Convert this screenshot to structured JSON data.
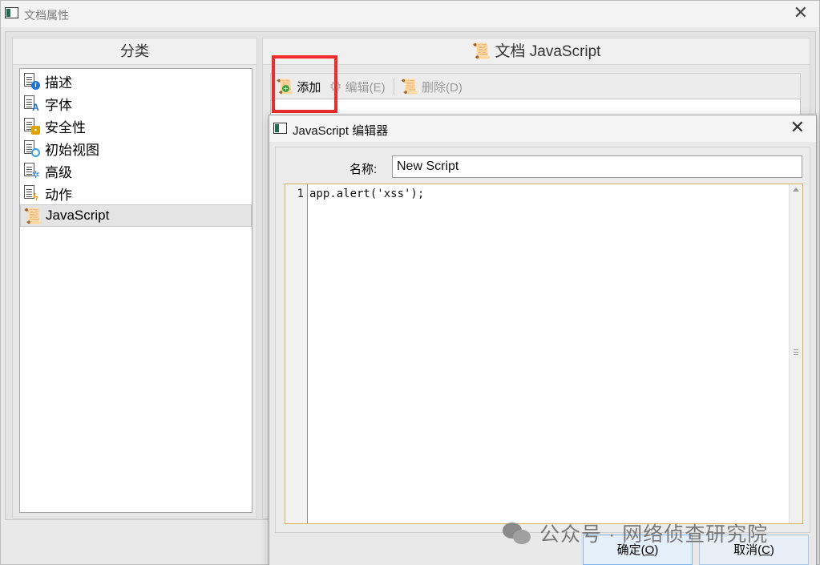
{
  "main_window": {
    "title": "文档属性",
    "close_symbol": "✕"
  },
  "left_panel": {
    "header": "分类",
    "items": [
      {
        "label": "描述",
        "icon": "document-info-icon",
        "badge_color": "#1e73d8"
      },
      {
        "label": "字体",
        "icon": "document-font-icon",
        "badge_color": "#1e73d8"
      },
      {
        "label": "安全性",
        "icon": "document-lock-icon",
        "badge_color": "#e0a400"
      },
      {
        "label": "初始视图",
        "icon": "document-magnifier-icon",
        "badge_color": "#3aa0e0"
      },
      {
        "label": "高级",
        "icon": "document-gear-icon",
        "badge_color": "#2b86d6"
      },
      {
        "label": "动作",
        "icon": "document-lightning-icon",
        "badge_color": "#f0a000"
      },
      {
        "label": "JavaScript",
        "icon": "script-scroll-icon",
        "selected": true
      }
    ]
  },
  "right_panel": {
    "header": "文档 JavaScript",
    "toolbar": {
      "add_label": "添加",
      "edit_label": "编辑(E)",
      "delete_label": "删除(D)"
    }
  },
  "dialog": {
    "title": "JavaScript 编辑器",
    "close_symbol": "✕",
    "name_label": "名称:",
    "name_value": "New Script",
    "line_number": "1",
    "code": "app.alert('xss');",
    "ok_label_pre": "确定(",
    "ok_key": "O",
    "ok_label_post": ")",
    "cancel_label_pre": "取消(",
    "cancel_key": "C",
    "cancel_label_post": ")"
  },
  "watermark": {
    "text": "公众号 · 网络侦查研究院"
  },
  "colors": {
    "highlight_border": "#ef2b2b",
    "editor_border": "#d9b455",
    "ok_button_border": "#7eb4ea"
  }
}
